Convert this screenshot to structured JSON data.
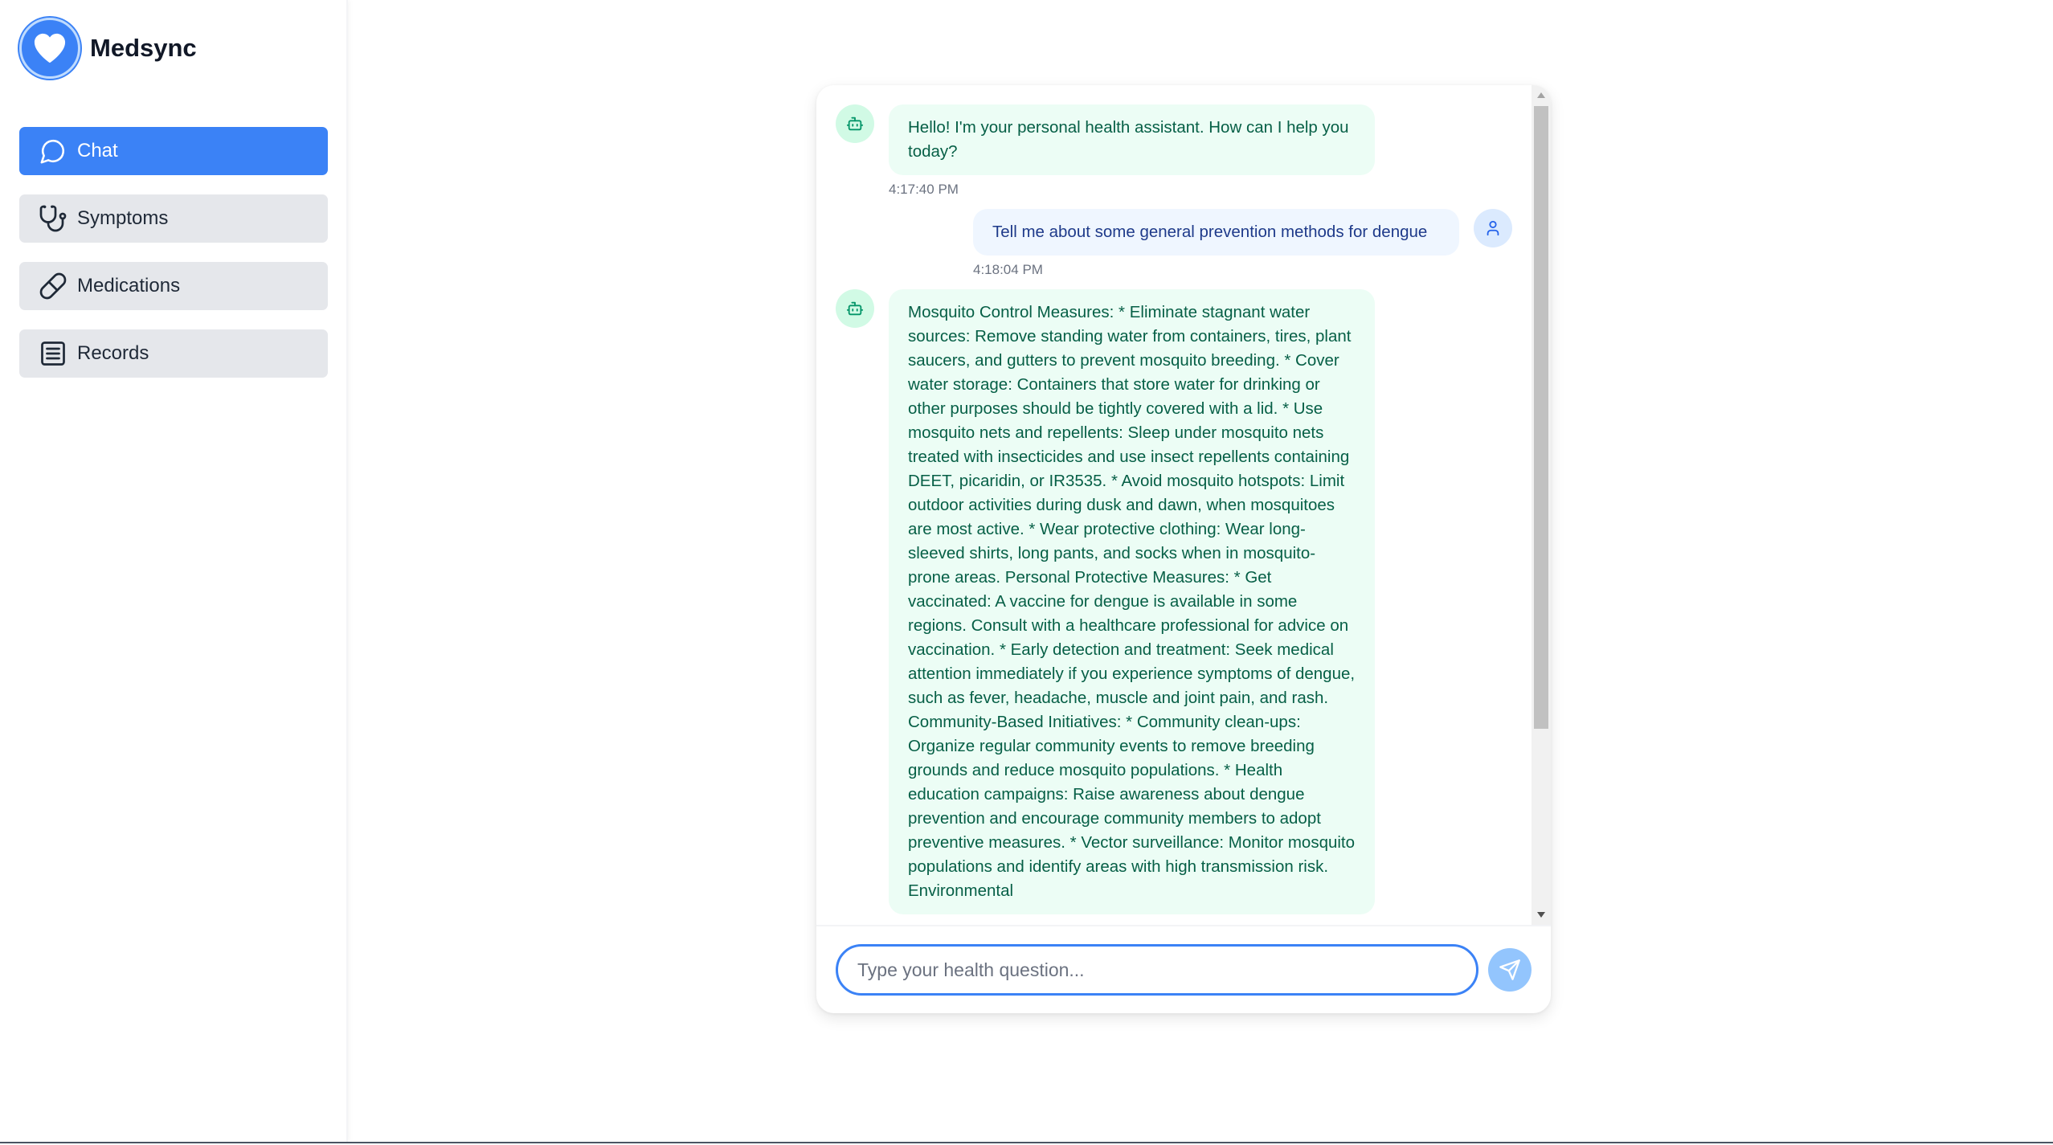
{
  "brand": {
    "name": "Medsync"
  },
  "nav": {
    "items": [
      {
        "label": "Chat",
        "icon": "message-circle-icon",
        "active": true
      },
      {
        "label": "Symptoms",
        "icon": "stethoscope-icon",
        "active": false
      },
      {
        "label": "Medications",
        "icon": "pill-icon",
        "active": false
      },
      {
        "label": "Records",
        "icon": "document-list-icon",
        "active": false
      }
    ]
  },
  "chat": {
    "messages": [
      {
        "sender": "bot",
        "text": "Hello! I'm your personal health assistant. How can I help you today?",
        "time": "4:17:40 PM"
      },
      {
        "sender": "user",
        "text": "Tell me about some general prevention methods for dengue",
        "time": "4:18:04 PM"
      },
      {
        "sender": "bot",
        "text": "Mosquito Control Measures: * Eliminate stagnant water sources: Remove standing water from containers, tires, plant saucers, and gutters to prevent mosquito breeding. * Cover water storage: Containers that store water for drinking or other purposes should be tightly covered with a lid. * Use mosquito nets and repellents: Sleep under mosquito nets treated with insecticides and use insect repellents containing DEET, picaridin, or IR3535. * Avoid mosquito hotspots: Limit outdoor activities during dusk and dawn, when mosquitoes are most active. * Wear protective clothing: Wear long-sleeved shirts, long pants, and socks when in mosquito-prone areas. Personal Protective Measures: * Get vaccinated: A vaccine for dengue is available in some regions. Consult with a healthcare professional for advice on vaccination. * Early detection and treatment: Seek medical attention immediately if you experience symptoms of dengue, such as fever, headache, muscle and joint pain, and rash. Community-Based Initiatives: * Community clean-ups: Organize regular community events to remove breeding grounds and reduce mosquito populations. * Health education campaigns: Raise awareness about dengue prevention and encourage community members to adopt preventive measures. * Vector surveillance: Monitor mosquito populations and identify areas with high transmission risk. Environmental"
      }
    ],
    "input_placeholder": "Type your health question...",
    "input_value": ""
  },
  "colors": {
    "accent": "#3b82f6",
    "bot_bubble": "#ecfdf5",
    "user_bubble": "#eff6ff",
    "send_button": "#93c5fd"
  }
}
